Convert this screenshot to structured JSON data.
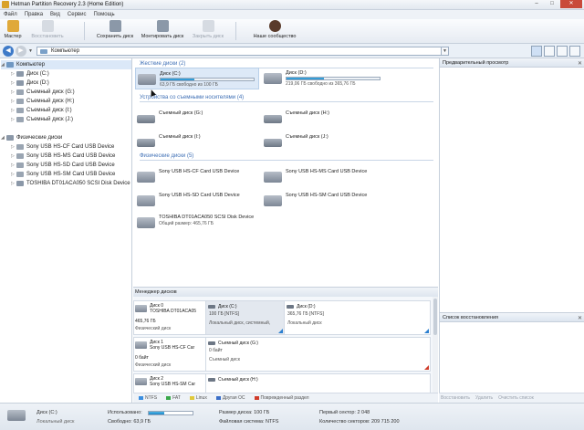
{
  "window": {
    "title": "Hetman Partition Recovery 2.3 (Home Edition)",
    "minimize": "–",
    "maximize": "□",
    "close": "✕"
  },
  "menu": [
    "Файл",
    "Правка",
    "Вид",
    "Сервис",
    "Помощь"
  ],
  "toolbar": {
    "wizard": "Мастер",
    "restore": "Восстановить",
    "save_disk": "Сохранить диск",
    "mount_disk": "Монтировать диск",
    "close_disk": "Закрыть диск",
    "community": "Наше сообщество"
  },
  "address": {
    "value": "Компьютер"
  },
  "tree": {
    "items": [
      {
        "label": "Компьютер",
        "level": 0
      },
      {
        "label": "Диск (C:)",
        "level": 1
      },
      {
        "label": "Диск (D:)",
        "level": 1
      },
      {
        "label": "Съемный диск (G:)",
        "level": 1
      },
      {
        "label": "Съемный диск (H:)",
        "level": 1
      },
      {
        "label": "Съемный диск (I:)",
        "level": 1
      },
      {
        "label": "Съемный диск (J:)",
        "level": 1
      },
      {
        "label": "Физические диски",
        "level": 0
      },
      {
        "label": "Sony USB   HS-CF Card USB Device",
        "level": 1
      },
      {
        "label": "Sony USB   HS-MS Card USB Device",
        "level": 1
      },
      {
        "label": "Sony USB   HS-SD Card USB Device",
        "level": 1
      },
      {
        "label": "Sony USB   HS-SM Card USB Device",
        "level": 1
      },
      {
        "label": "TOSHIBA DT01ACA050 SCSI Disk Device",
        "level": 1
      }
    ]
  },
  "sections": {
    "hard_disks": "Жесткие диски (2)",
    "removable": "Устройства со съемными носителями (4)",
    "physical": "Физические диски (5)"
  },
  "hard_disks": [
    {
      "name": "Диск (C:)",
      "free": "63,9 ГБ свободно из 100 ГБ",
      "used_fraction": 0.36
    },
    {
      "name": "Диск (D:)",
      "free": "219,06 ГБ свободно из 365,76 ГБ",
      "used_fraction": 0.4
    }
  ],
  "removable": [
    {
      "name": "Съемный диск (G:)"
    },
    {
      "name": "Съемный диск (H:)"
    },
    {
      "name": "Съемный диск (I:)"
    },
    {
      "name": "Съемный диск (J:)"
    }
  ],
  "physical": [
    {
      "name": "Sony USB   HS-CF Card USB Device",
      "sub": ""
    },
    {
      "name": "Sony USB   HS-MS Card USB Device",
      "sub": ""
    },
    {
      "name": "Sony USB   HS-SD Card USB Device",
      "sub": ""
    },
    {
      "name": "Sony USB   HS-SM Card USB Device",
      "sub": ""
    },
    {
      "name": "TOSHIBA DT01ACA050 SCSI Disk Device",
      "sub": "Общий размер: 465,76 ГБ"
    }
  ],
  "disk_manager": {
    "title": "Менеджер дисков",
    "disks": [
      {
        "id": "Диск 0",
        "model": "TOSHIBA DT01ACA05",
        "size": "465,76 ГБ",
        "type": "Физический диск",
        "partitions": [
          {
            "name": "Диск (C:)",
            "size": "100 ГБ [NTFS]",
            "desc": "Локальный диск, системный,",
            "corner": "blue"
          },
          {
            "name": "Диск (D:)",
            "size": "365,76 ГБ [NTFS]",
            "desc": "Локальный диск",
            "corner": "blue"
          }
        ]
      },
      {
        "id": "Диск 1",
        "model": "Sony USB  HS-CF Car",
        "size": "0 байт",
        "type": "Физический диск",
        "partitions": [
          {
            "name": "Съемный диск (G:)",
            "size": "0 байт",
            "desc": "Съемный диск",
            "corner": "red"
          }
        ]
      },
      {
        "id": "Диск 2",
        "model": "Sony USB  HS-SM Car",
        "size": "",
        "type": "",
        "partitions": [
          {
            "name": "Съемный диск (H:)",
            "size": "",
            "desc": "",
            "corner": ""
          }
        ]
      }
    ]
  },
  "legend": [
    {
      "label": "NTFS",
      "color": "#3a8ee0"
    },
    {
      "label": "FAT",
      "color": "#3aa84a"
    },
    {
      "label": "Linux",
      "color": "#e0c93a"
    },
    {
      "label": "Другая ОС",
      "color": "#3a6ec8"
    },
    {
      "label": "Поврежденный раздел",
      "color": "#d03c2b"
    }
  ],
  "preview": {
    "title": "Предварительный просмотр"
  },
  "recovery_list": {
    "title": "Список восстановления",
    "actions": [
      "Восстановить",
      "Удалить",
      "Очистить список"
    ]
  },
  "status": {
    "disk_name": "Диск (C:)",
    "disk_type": "Локальный диск",
    "used_label": "Использовано:",
    "used_fraction": 0.36,
    "free_label": "Свободно: 63,9 ГБ",
    "size_label": "Размер диска: 100 ГБ",
    "fs_label": "Файловая система: NTFS",
    "first_sector": "Первый сектор: 2 048",
    "sector_count": "Количество секторов: 209 715 200"
  }
}
